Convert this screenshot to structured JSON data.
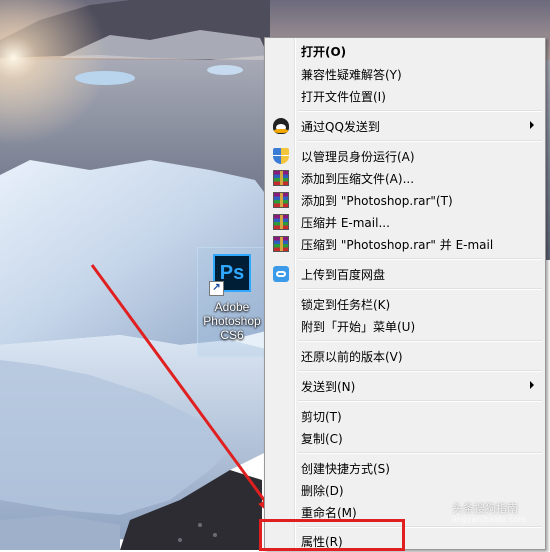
{
  "desktop_icon": {
    "name_lines": [
      "Adobe",
      "Photoshop",
      "CS6"
    ],
    "logo_text": "Ps",
    "shortcut_glyph": "↗"
  },
  "context_menu": {
    "items": [
      {
        "label": "打开(O)",
        "bold": true,
        "icon": null,
        "submenu": false
      },
      {
        "label": "兼容性疑难解答(Y)",
        "icon": null,
        "submenu": false
      },
      {
        "label": "打开文件位置(I)",
        "icon": null,
        "submenu": false
      },
      {
        "label": "通过QQ发送到",
        "icon": "qq-icon",
        "submenu": true
      },
      {
        "label": "以管理员身份运行(A)",
        "icon": "uac-shield-icon",
        "submenu": false
      },
      {
        "label": "添加到压缩文件(A)...",
        "icon": "winrar-icon",
        "submenu": false
      },
      {
        "label": "添加到 \"Photoshop.rar\"(T)",
        "icon": "winrar-icon",
        "submenu": false
      },
      {
        "label": "压缩并 E-mail...",
        "icon": "winrar-icon",
        "submenu": false
      },
      {
        "label": "压缩到 \"Photoshop.rar\" 并 E-mail",
        "icon": "winrar-icon",
        "submenu": false
      },
      {
        "label": "上传到百度网盘",
        "icon": "baidu-cloud-icon",
        "submenu": false
      },
      {
        "label": "锁定到任务栏(K)",
        "icon": null,
        "submenu": false
      },
      {
        "label": "附到「开始」菜单(U)",
        "icon": null,
        "submenu": false
      },
      {
        "label": "还原以前的版本(V)",
        "icon": null,
        "submenu": false
      },
      {
        "label": "发送到(N)",
        "icon": null,
        "submenu": true
      },
      {
        "label": "剪切(T)",
        "icon": null,
        "submenu": false
      },
      {
        "label": "复制(C)",
        "icon": null,
        "submenu": false
      },
      {
        "label": "创建快捷方式(S)",
        "icon": null,
        "submenu": false
      },
      {
        "label": "删除(D)",
        "icon": null,
        "submenu": false
      },
      {
        "label": "重命名(M)",
        "icon": null,
        "submenu": false
      },
      {
        "label": "属性(R)",
        "icon": null,
        "submenu": false
      }
    ]
  },
  "annotation": {
    "color": "#e02020"
  },
  "watermark": {
    "text": "头条搜狗指南",
    "sub": "jingyan.baidu.com"
  }
}
